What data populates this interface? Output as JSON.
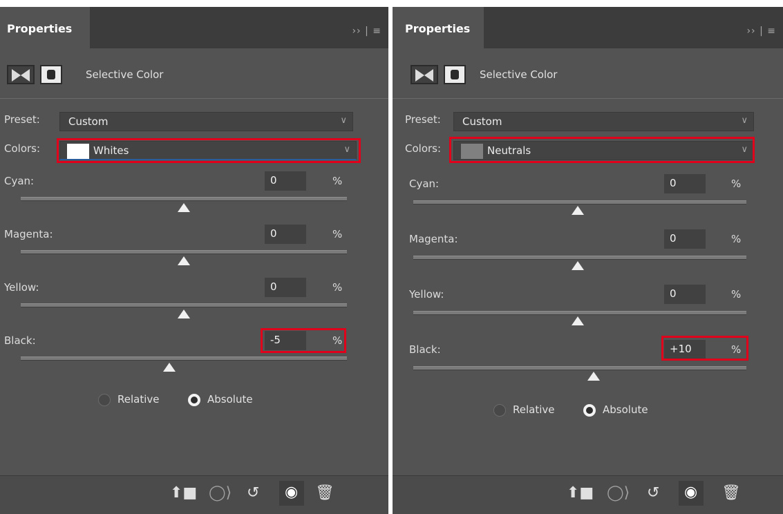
{
  "panels": [
    {
      "tab_label": "Properties",
      "header_menu": "›› | ≡",
      "adjustment_name": "Selective Color",
      "preset_label": "Preset:",
      "preset_value": "Custom",
      "colors_label": "Colors:",
      "colors_value": "Whites",
      "colors_swatch": "#ffffff",
      "sliders": [
        {
          "label": "Cyan:",
          "value": "0",
          "unit": "%"
        },
        {
          "label": "Magenta:",
          "value": "0",
          "unit": "%"
        },
        {
          "label": "Yellow:",
          "value": "0",
          "unit": "%"
        },
        {
          "label": "Black:",
          "value": "-5",
          "unit": "%"
        }
      ],
      "method": {
        "relative_label": "Relative",
        "absolute_label": "Absolute",
        "selected": "Absolute"
      },
      "footer_icons": [
        "clip-to-layer-icon",
        "view-previous-state-icon",
        "reset-icon",
        "visibility-icon",
        "delete-icon"
      ]
    },
    {
      "tab_label": "Properties",
      "header_menu": "›› | ≡",
      "adjustment_name": "Selective Color",
      "preset_label": "Preset:",
      "preset_value": "Custom",
      "colors_label": "Colors:",
      "colors_value": "Neutrals",
      "colors_swatch": "#808080",
      "sliders": [
        {
          "label": "Cyan:",
          "value": "0",
          "unit": "%"
        },
        {
          "label": "Magenta:",
          "value": "0",
          "unit": "%"
        },
        {
          "label": "Yellow:",
          "value": "0",
          "unit": "%"
        },
        {
          "label": "Black:",
          "value": "+10",
          "unit": "%"
        }
      ],
      "method": {
        "relative_label": "Relative",
        "absolute_label": "Absolute",
        "selected": "Absolute"
      },
      "footer_icons": [
        "clip-to-layer-icon",
        "view-previous-state-icon",
        "reset-icon",
        "visibility-icon",
        "delete-icon"
      ]
    }
  ],
  "highlight_color": "#e0001b",
  "colors": {
    "panel_bg": "#535353",
    "header_bg": "#3c3c3c",
    "field_bg": "#434343"
  }
}
